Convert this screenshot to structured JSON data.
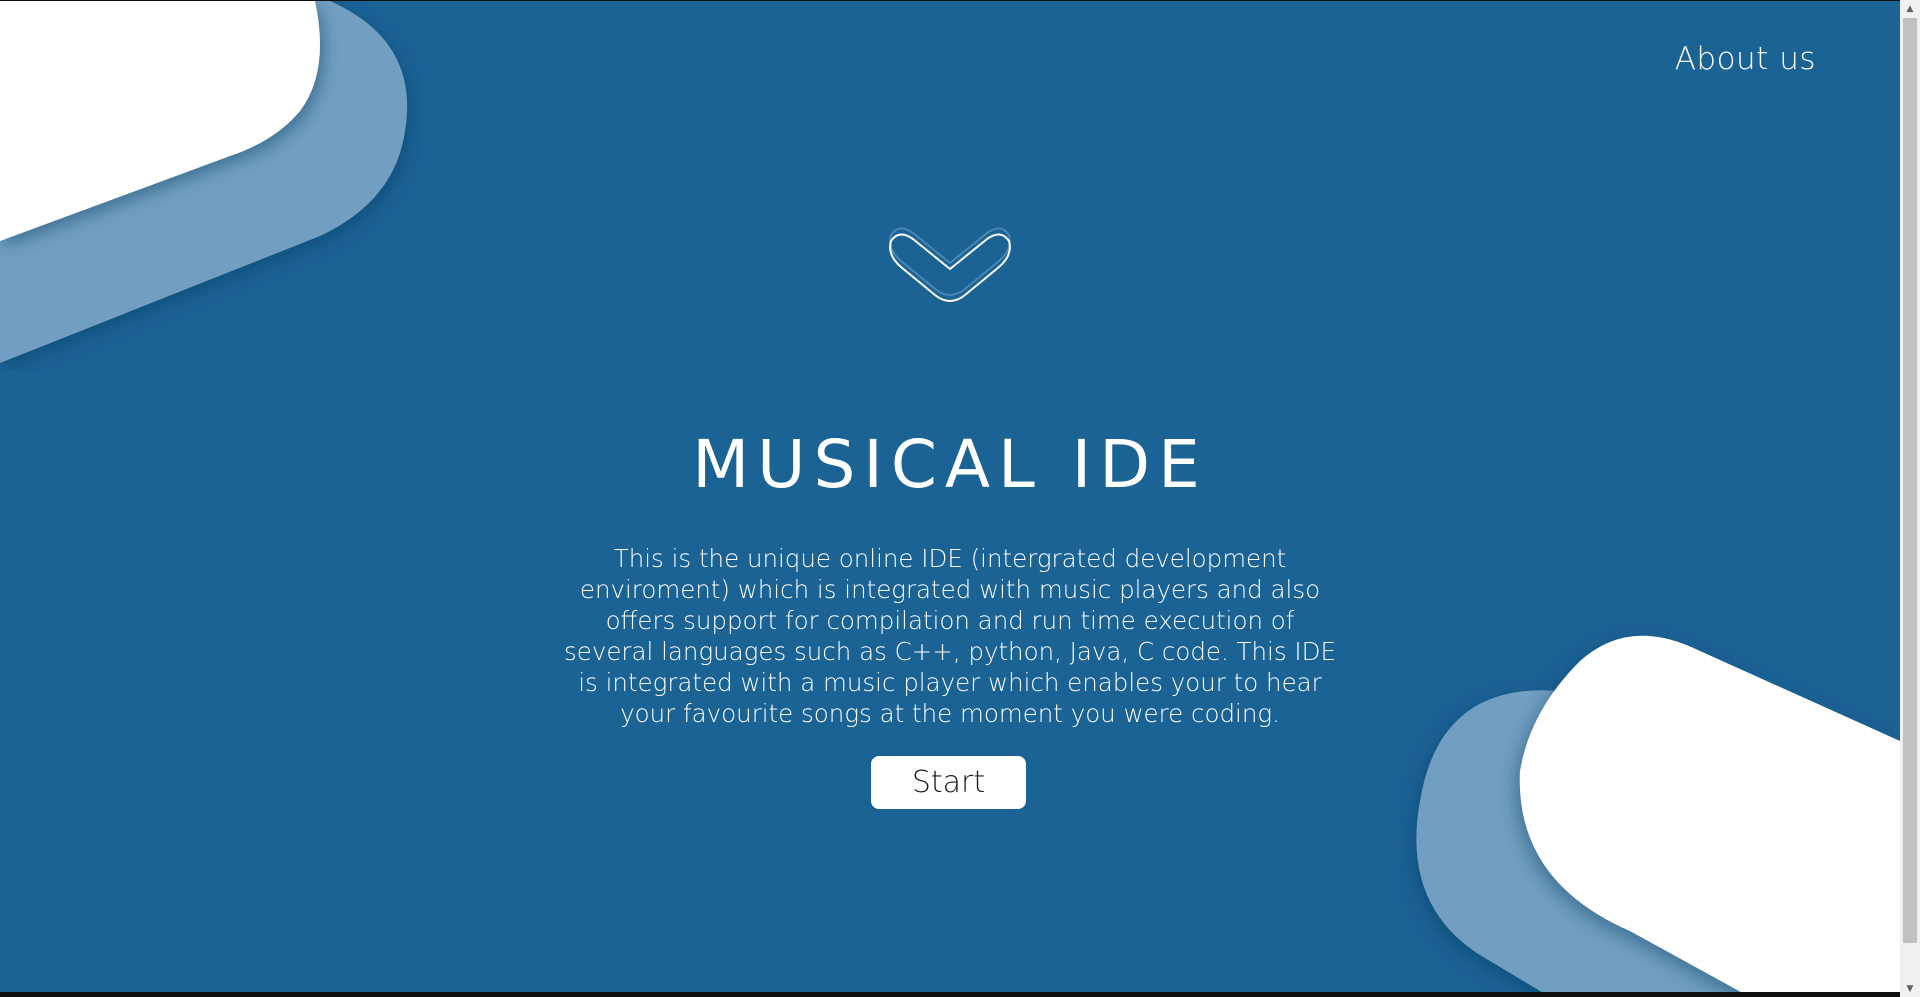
{
  "nav": {
    "about_label": "About us"
  },
  "hero": {
    "title": "MUSICAL IDE",
    "description": "This is the unique online IDE (intergrated development enviroment) which is integrated with music players and also offers support for compilation and run time execution of several languages such as C++, python, Java, C code. This IDE is integrated with a music player which enables your to hear your favourite songs at the moment you were coding.",
    "start_label": "Start",
    "scroll_icon": "chevron-down-icon"
  },
  "colors": {
    "background": "#1b6295",
    "blob_light": "#729fc1",
    "blob_white": "#ffffff",
    "text": "#ffffff"
  }
}
